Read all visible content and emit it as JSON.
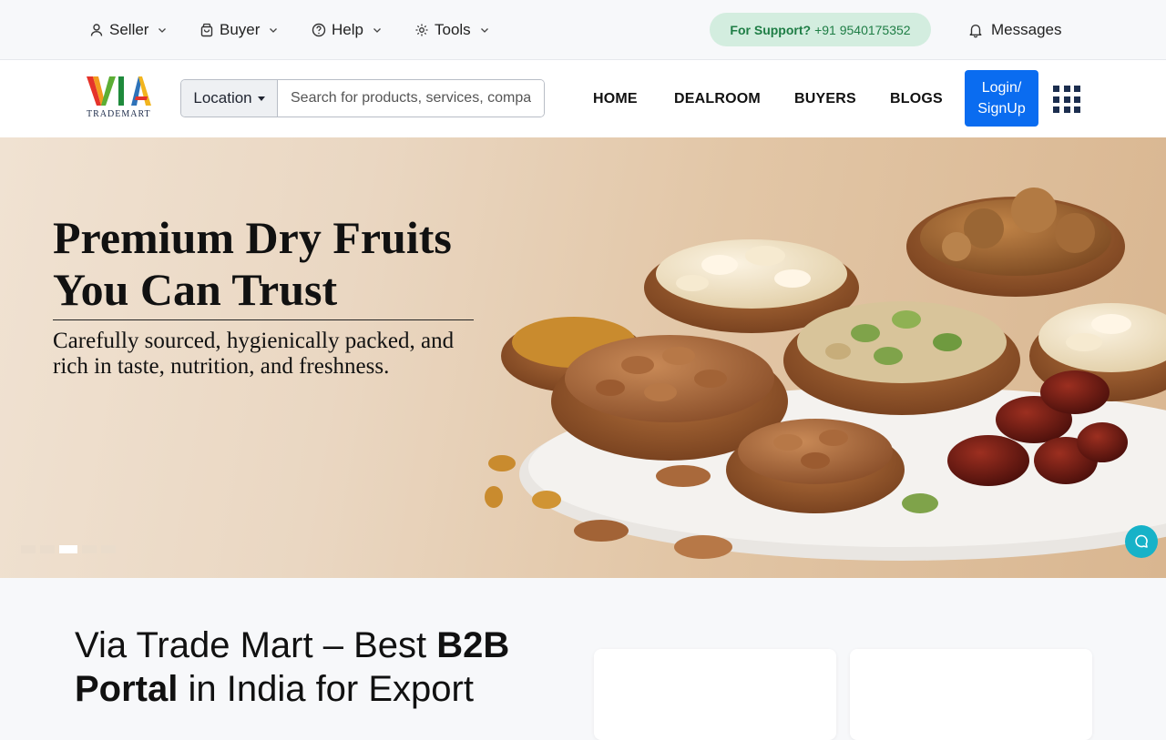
{
  "topbar": {
    "menus": [
      {
        "label": "Seller",
        "icon": "user-icon"
      },
      {
        "label": "Buyer",
        "icon": "bag-icon"
      },
      {
        "label": "Help",
        "icon": "help-icon"
      },
      {
        "label": "Tools",
        "icon": "gear-icon"
      }
    ],
    "support_label": "For Support?",
    "support_phone": "+91 9540175352",
    "messages_label": "Messages"
  },
  "navbar": {
    "logo_text": "VIA",
    "logo_subtext": "TRADEMART",
    "location_label": "Location",
    "search_placeholder": "Search for products, services, companies",
    "links": [
      "HOME",
      "DEALROOM",
      "BUYERS",
      "BLOGS"
    ],
    "login_label_1": "Login/",
    "login_label_2": "SignUp"
  },
  "hero": {
    "title_line1": "Premium Dry Fruits",
    "title_line2": "You Can Trust",
    "subtitle_line1": "Carefully sourced, hygienically packed, and",
    "subtitle_line2": "rich in taste, nutrition, and freshness.",
    "slides_count": 5,
    "active_slide": 3
  },
  "about": {
    "title_part1": "Via Trade Mart – Best ",
    "title_bold1": "B2B",
    "title_bold2": "Portal",
    "title_part2": " in India for Export"
  },
  "colors": {
    "primary": "#0a6cf0",
    "support_bg": "#d3eddf",
    "support_text": "#1e7d45",
    "chat": "#17b2c8"
  }
}
